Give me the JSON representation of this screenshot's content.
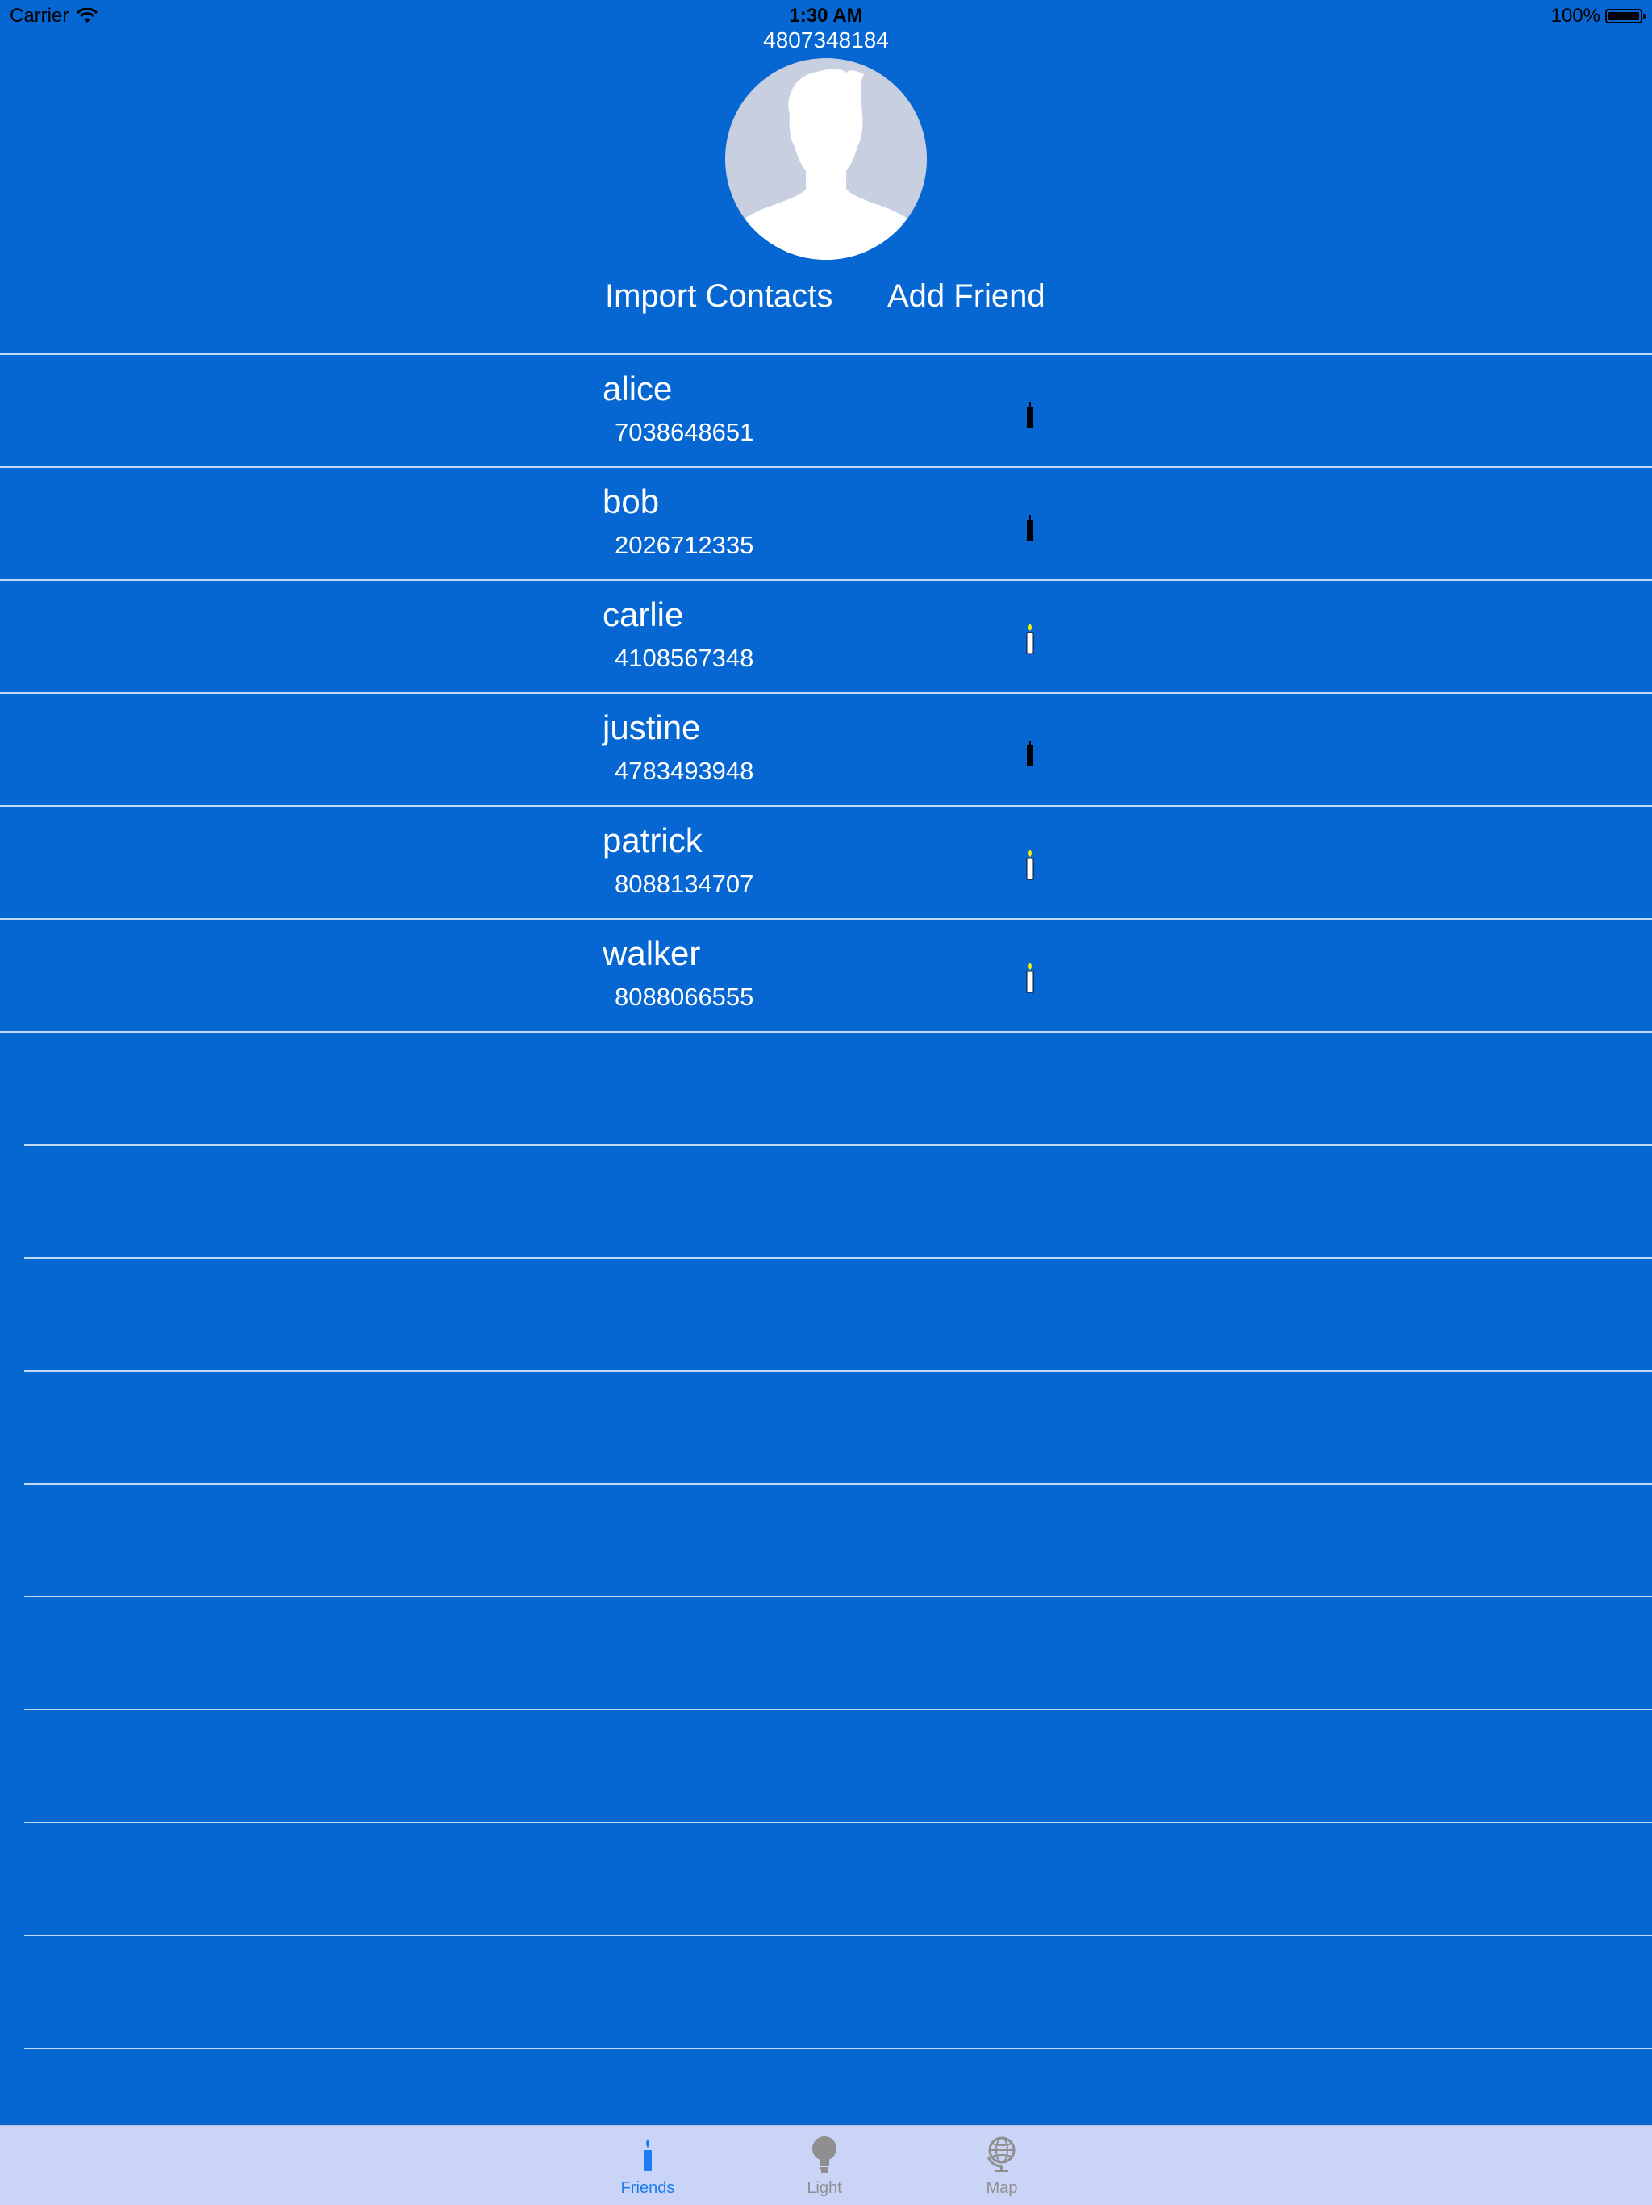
{
  "status_bar": {
    "carrier": "Carrier",
    "time": "1:30 AM",
    "battery": "100%"
  },
  "header": {
    "phone": "4807348184",
    "import_label": "Import Contacts",
    "add_label": "Add Friend"
  },
  "friends": [
    {
      "name": "alice",
      "phone": "7038648651",
      "candle": "unlit"
    },
    {
      "name": "bob",
      "phone": "2026712335",
      "candle": "unlit"
    },
    {
      "name": "carlie",
      "phone": "4108567348",
      "candle": "lit"
    },
    {
      "name": "justine",
      "phone": "4783493948",
      "candle": "unlit"
    },
    {
      "name": "patrick",
      "phone": "8088134707",
      "candle": "lit"
    },
    {
      "name": "walker",
      "phone": "8088066555",
      "candle": "lit"
    }
  ],
  "tabs": [
    {
      "label": "Friends",
      "icon": "candle-icon",
      "active": true
    },
    {
      "label": "Light",
      "icon": "lightbulb-icon",
      "active": false
    },
    {
      "label": "Map",
      "icon": "globe-icon",
      "active": false
    }
  ],
  "colors": {
    "background": "#0667d3",
    "tab_bar": "#cad4f7",
    "active_tab": "#1a7cf0",
    "inactive_tab": "#8f8f8f",
    "flame": "#f4f000"
  }
}
